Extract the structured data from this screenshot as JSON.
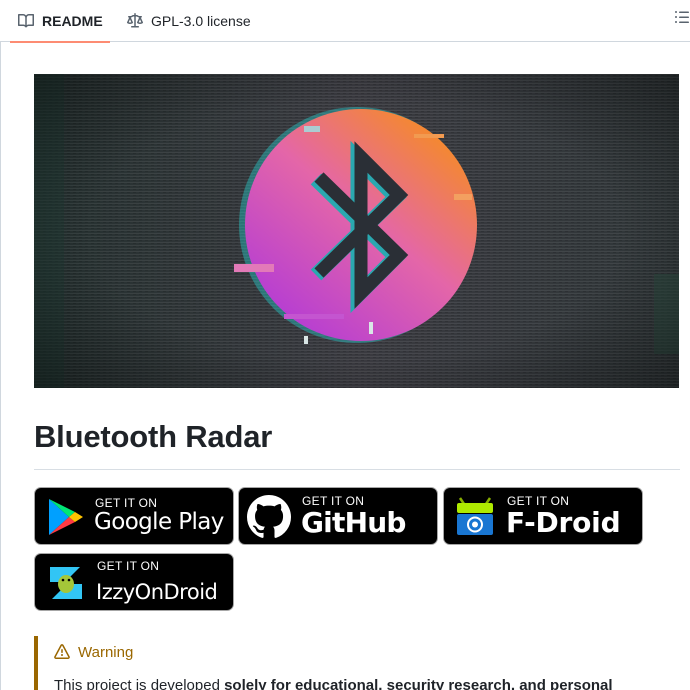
{
  "tabs": [
    {
      "label": "README",
      "icon": "book-icon",
      "active": true
    },
    {
      "label": "GPL-3.0 license",
      "icon": "scale-icon",
      "active": false
    }
  ],
  "toolbar": {
    "outline_icon": "list-unordered-icon"
  },
  "banner": {
    "alt": "Bluetooth Radar banner",
    "icon": "bluetooth-icon"
  },
  "readme": {
    "title": "Bluetooth Radar",
    "badges": [
      {
        "small": "GET IT ON",
        "big": "Google Play",
        "icon": "google-play-icon"
      },
      {
        "small": "GET IT ON",
        "big": "GitHub",
        "icon": "github-icon"
      },
      {
        "small": "GET IT ON",
        "big": "F-Droid",
        "icon": "fdroid-icon"
      },
      {
        "small": "GET IT ON",
        "big": "IzzyOnDroid",
        "icon": "izzyondroid-icon"
      }
    ],
    "warning": {
      "title": "Warning",
      "text_start": "This project is developed ",
      "text_bold": "solely for educational, security research, and personal"
    }
  },
  "colors": {
    "accent_underline": "#fd8c73",
    "warning": "#9a6700",
    "border": "#d0d7de"
  }
}
